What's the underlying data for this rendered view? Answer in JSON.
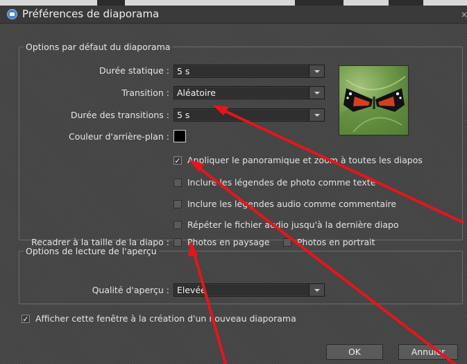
{
  "window": {
    "title": "Préférences de diaporama",
    "close_glyph": "×"
  },
  "defaults_group": {
    "legend": "Options par défaut du diaporama",
    "static_duration": {
      "label": "Durée statique :",
      "value": "5 s"
    },
    "transition": {
      "label": "Transition :",
      "value": "Aléatoire"
    },
    "transition_duration": {
      "label": "Durée des transitions :",
      "value": "5 s"
    },
    "background_color": {
      "label": "Couleur d'arrière-plan :",
      "color": "#000000"
    },
    "checkboxes": [
      {
        "label": "Appliquer le panoramique et zoom à toutes les diapos",
        "checked": true
      },
      {
        "label": "Inclure les légendes de photo comme texte",
        "checked": false
      },
      {
        "label": "Inclure les légendes audio comme commentaire",
        "checked": false
      },
      {
        "label": "Répéter le fichier audio jusqu'à la dernière diapo",
        "checked": false
      }
    ],
    "crop": {
      "label": "Recadrer à la taille de la diapo :",
      "landscape": {
        "label": "Photos en paysage",
        "checked": false
      },
      "portrait": {
        "label": "Photos en portrait",
        "checked": false
      }
    },
    "thumbnail_icon": "butterfly-photo"
  },
  "preview_group": {
    "legend": "Options de lecture de l'aperçu",
    "quality": {
      "label": "Qualité d'aperçu :",
      "value": "Elevée"
    }
  },
  "show_on_create": {
    "label": "Afficher cette fenêtre à la création d'un nouveau diaporama",
    "checked": true
  },
  "buttons": {
    "ok": "OK",
    "cancel": "Annuler"
  },
  "annotation_color": "#e8141b"
}
